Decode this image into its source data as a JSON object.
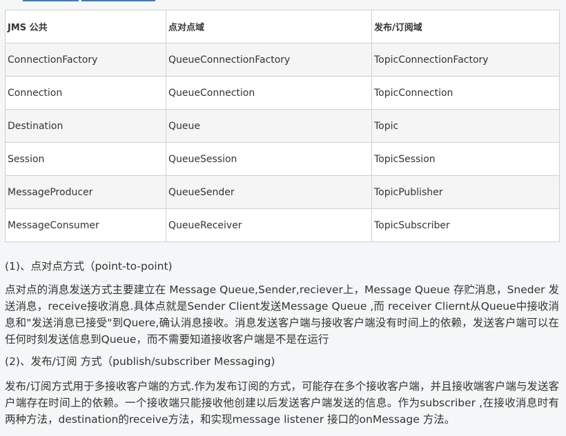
{
  "table": {
    "headers": [
      "JMS 公共",
      "点对点域",
      "发布/订阅域"
    ],
    "rows": [
      [
        "ConnectionFactory",
        "QueueConnectionFactory",
        "TopicConnectionFactory"
      ],
      [
        "Connection",
        "QueueConnection",
        "TopicConnection"
      ],
      [
        "Destination",
        "Queue",
        "Topic"
      ],
      [
        "Session",
        "QueueSession",
        "TopicSession"
      ],
      [
        "MessageProducer",
        "QueueSender",
        "TopicPublisher"
      ],
      [
        "MessageConsumer",
        "QueueReceiver",
        "TopicSubscriber"
      ]
    ]
  },
  "sections": [
    {
      "heading": "(1)、点对点方式（point-to-point)",
      "body": "点对点的消息发送方式主要建立在 Message Queue,Sender,reciever上，Message Queue 存贮消息，Sneder 发送消息，receive接收消息.具体点就是Sender Client发送Message Queue ,而 receiver Cliernt从Queue中接收消息和\"发送消息已接受\"到Quere,确认消息接收。消息发送客户端与接收客户端没有时间上的依赖，发送客户端可以在任何时刻发送信息到Queue，而不需要知道接收客户端是不是在运行"
    },
    {
      "heading": "(2)、发布/订阅 方式（publish/subscriber Messaging)",
      "body": "发布/订阅方式用于多接收客户端的方式.作为发布订阅的方式，可能存在多个接收客户端，并且接收端客户端与发送客户端存在时间上的依赖。一个接收端只能接收他创建以后发送客户端发送的信息。作为subscriber ,在接收消息时有两种方法，destination的receive方法，和实现message listener 接口的onMessage 方法。"
    }
  ]
}
